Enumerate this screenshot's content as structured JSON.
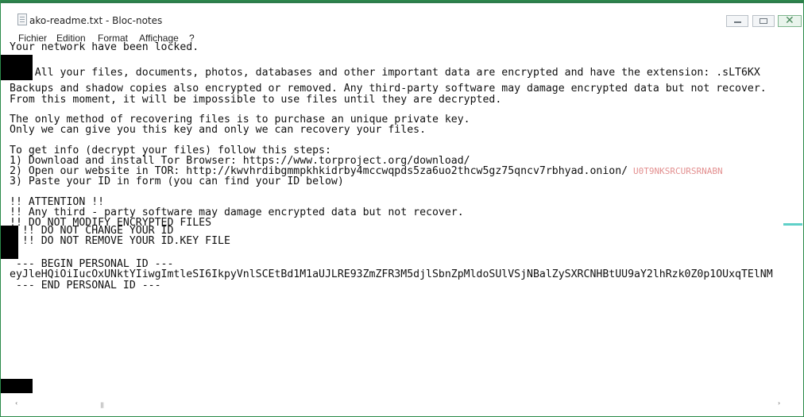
{
  "window": {
    "title": "ako-readme.txt - Bloc-notes"
  },
  "menu": {
    "items": [
      "Fichier",
      "Edition",
      "Format",
      "Affichage",
      "?"
    ]
  },
  "document": {
    "lines": [
      "Your network have been locked.",
      "    All your files, documents, photos, databases and other important data are encrypted and have the extension: .sLT6KX",
      "Backups and shadow copies also encrypted or removed. Any third-party software may damage encrypted data but not recover.",
      "From this moment, it will be impossible to use files until they are decrypted.",
      "The only method of recovering files is to purchase an unique private key.",
      "Only we can give you this key and only we can recovery your files.",
      "To get info (decrypt your files) follow this steps:",
      "1) Download and install Tor Browser: https://www.torproject.org/download/",
      "2) Open our website in TOR: http://kwvhrdibgmmpkhkidrby4mccwqpds5za6uo2thcw5gz75qncv7rbhyad.onion/",
      "3) Paste your ID in form (you can find your ID below)",
      "!! ATTENTION !!",
      "!! Any third - party software may damage encrypted data but not recover.",
      "!! DO NOT MODIFY ENCRYPTED FILES",
      "  !! DO NOT CHANGE YOUR ID",
      "  !! DO NOT REMOVE YOUR ID.KEY FILE",
      " --- BEGIN PERSONAL ID ---",
      "eyJleHQiOiIucOxUNktYIiwgImtleSI6IkpyVnlSCEtBd1M1aUJLRE93ZmZFR3M5djlSbnZpMldoSUlVSjNBalZySXRCNHBtUU9aY2lhRzk0Z0p1OUxqTElNM",
      " --- END PERSONAL ID ---"
    ],
    "onion_suffix_overlay": "U0T9NKSRCURSRNABN"
  },
  "statusbar": {
    "scroll_left": "‹",
    "scroll_right": "›",
    "scroll_thumb": "|||"
  }
}
